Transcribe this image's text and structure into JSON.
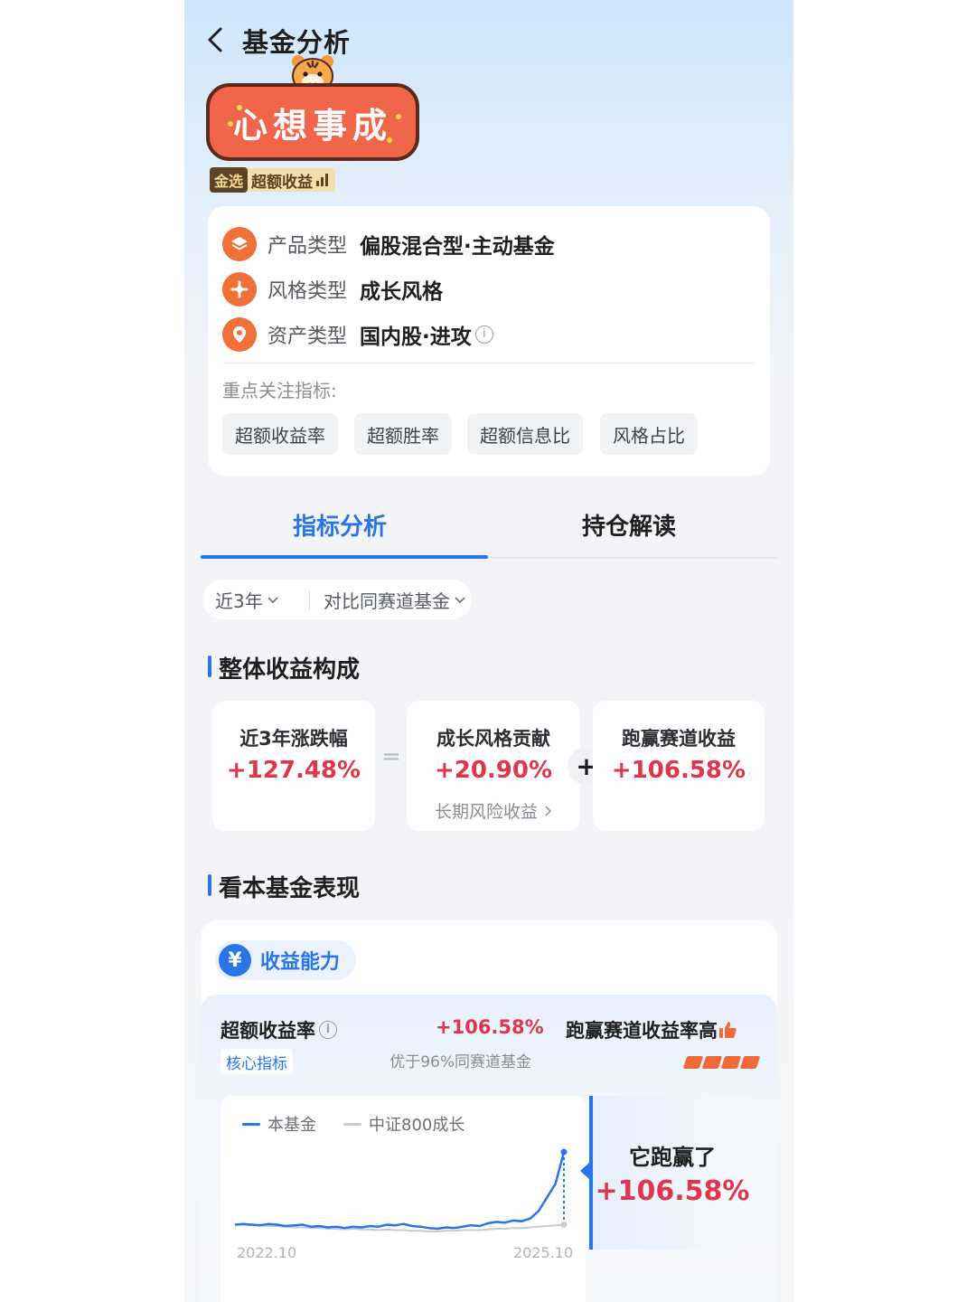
{
  "header": {
    "title": "基金分析",
    "back_icon": "chevron-left-icon"
  },
  "banner": {
    "slogan": "心想事成",
    "badge_tag": "金选",
    "badge_text": "超额收益"
  },
  "product_info": {
    "rows": [
      {
        "label": "产品类型",
        "value": "偏股混合型·主动基金",
        "icon": "layers-icon"
      },
      {
        "label": "风格类型",
        "value": "成长风格",
        "icon": "style-icon"
      },
      {
        "label": "资产类型",
        "value": "国内股·进攻",
        "icon": "location-pin-icon"
      }
    ],
    "focus_label": "重点关注指标:",
    "focus_chips": [
      "超额收益率",
      "超额胜率",
      "超额信息比",
      "风格占比"
    ]
  },
  "tabs": [
    {
      "label": "指标分析",
      "active": true
    },
    {
      "label": "持仓解读",
      "active": false
    }
  ],
  "filters": {
    "period": "近3年",
    "compare": "对比同赛道基金"
  },
  "composition": {
    "title": "整体收益构成",
    "cards": [
      {
        "label": "近3年涨跌幅",
        "value": "+127.48%"
      },
      {
        "label": "成长风格贡献",
        "value": "+20.90%",
        "sub": "长期风险收益"
      },
      {
        "label": "跑赢赛道收益",
        "value": "+106.58%"
      }
    ],
    "eq_symbol": "=",
    "plus_symbol": "+"
  },
  "performance": {
    "title": "看本基金表现",
    "capability": "收益能力",
    "capability_icon_glyph": "¥",
    "metric": {
      "name": "超额收益率",
      "core_tag": "核心指标",
      "value": "+106.58%",
      "compare": "优于96%同赛道基金",
      "win_label": "跑赢赛道收益率高",
      "level_filled": 4,
      "level_total": 4
    },
    "win_box": {
      "line1": "它跑赢了",
      "line2": "+106.58%"
    }
  },
  "chart_data": {
    "type": "line",
    "series": [
      {
        "name": "本基金",
        "color": "#2a74ea",
        "values": [
          100,
          101,
          100,
          99,
          101,
          100,
          98,
          99,
          100,
          97,
          98,
          96,
          97,
          95,
          97,
          96,
          98,
          97,
          100,
          99,
          101,
          98,
          97,
          95,
          94,
          96,
          95,
          97,
          99,
          98,
          102,
          104,
          103,
          106,
          105,
          109,
          120,
          140,
          160,
          206.58
        ]
      },
      {
        "name": "中证800成长",
        "color": "#c8ccd2",
        "values": [
          100,
          100,
          99,
          99,
          98,
          98,
          97,
          96,
          96,
          95,
          95,
          94,
          94,
          93,
          94,
          93,
          93,
          92,
          93,
          92,
          92,
          91,
          91,
          90,
          90,
          91,
          91,
          92,
          92,
          92,
          93,
          94,
          94,
          95,
          95,
          96,
          97,
          98,
          99,
          100
        ]
      }
    ],
    "x_start": "2022.10",
    "x_end": "2025.10"
  },
  "colors": {
    "accent": "#2a74ea",
    "positive": "#e0364c",
    "orange": "#f0703a"
  }
}
